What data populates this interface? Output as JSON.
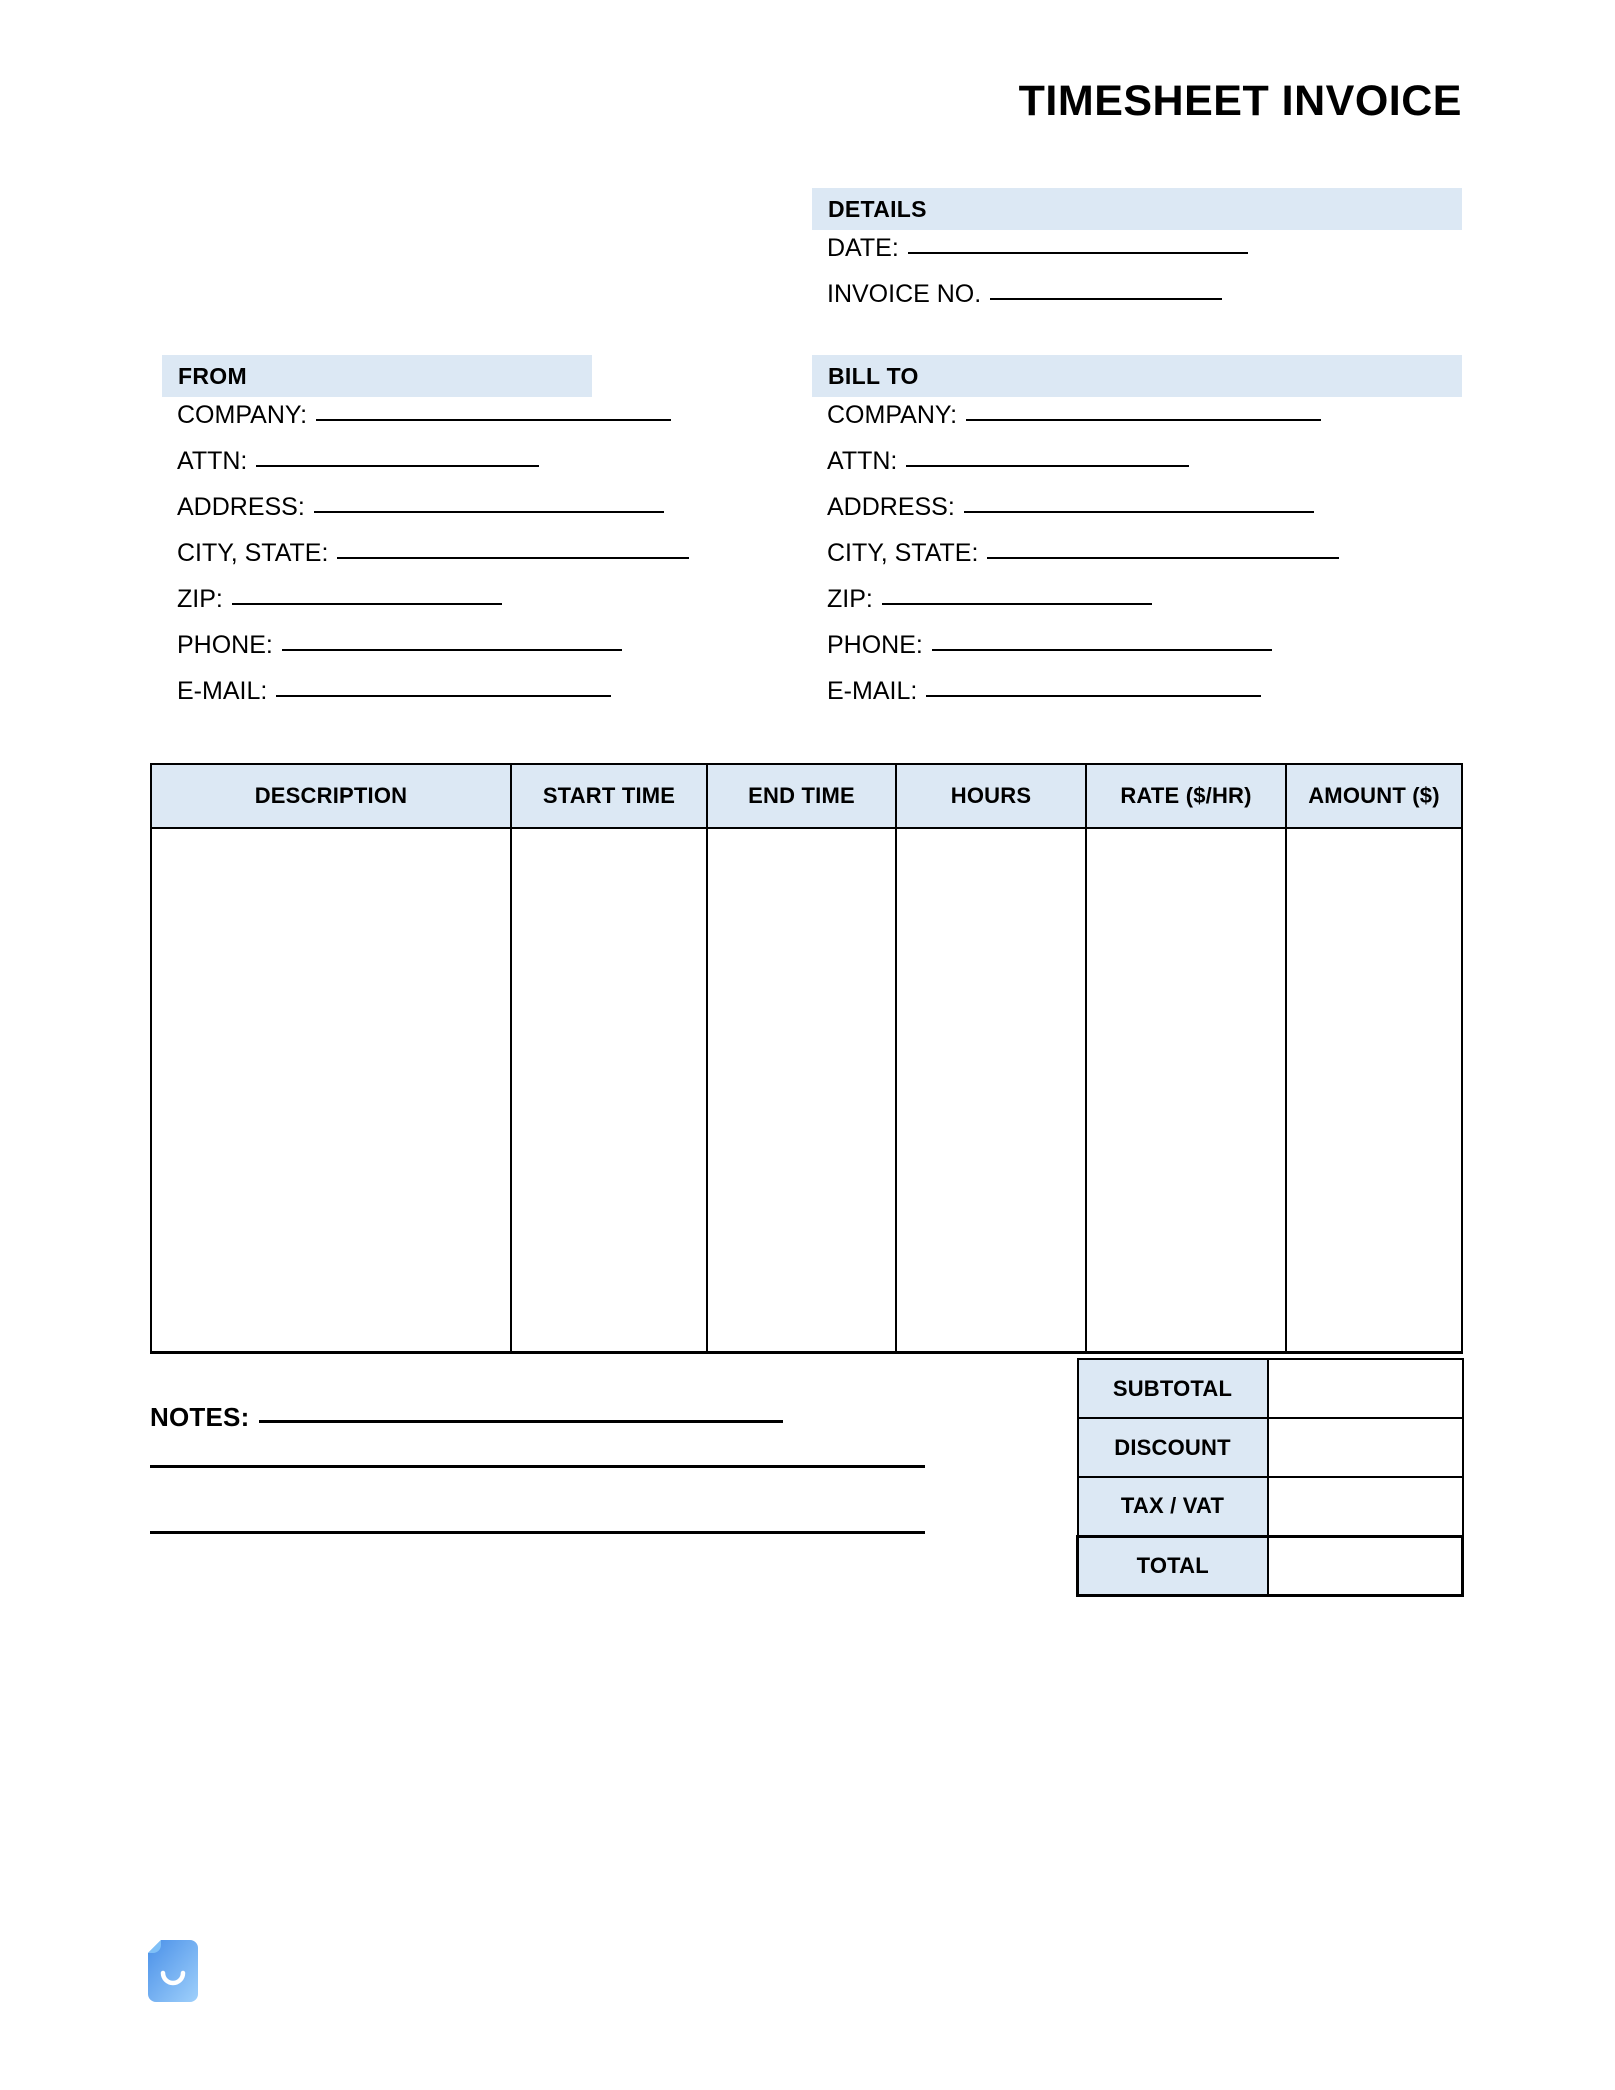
{
  "document": {
    "title": "TIMESHEET INVOICE"
  },
  "colors": {
    "band_background": "#dce8f4",
    "border": "#000000",
    "logo_gradient_start": "#4a90e8",
    "logo_gradient_end": "#9fd0fb"
  },
  "details": {
    "heading": "DETAILS",
    "fields": [
      {
        "label": "DATE:",
        "value": "",
        "rule_width": 340
      },
      {
        "label": "INVOICE NO.",
        "value": "",
        "rule_width": 232
      }
    ]
  },
  "from": {
    "heading": "FROM",
    "fields": [
      {
        "label": "COMPANY:",
        "value": "",
        "rule_width": 355
      },
      {
        "label": "ATTN:",
        "value": "",
        "rule_width": 283
      },
      {
        "label": "ADDRESS:",
        "value": "",
        "rule_width": 350
      },
      {
        "label": "CITY, STATE:",
        "value": "",
        "rule_width": 352
      },
      {
        "label": "ZIP:",
        "value": "",
        "rule_width": 270
      },
      {
        "label": "PHONE:",
        "value": "",
        "rule_width": 340
      },
      {
        "label": "E-MAIL:",
        "value": "",
        "rule_width": 335
      }
    ]
  },
  "bill_to": {
    "heading": "BILL TO",
    "fields": [
      {
        "label": "COMPANY:",
        "value": "",
        "rule_width": 355
      },
      {
        "label": "ATTN:",
        "value": "",
        "rule_width": 283
      },
      {
        "label": "ADDRESS:",
        "value": "",
        "rule_width": 350
      },
      {
        "label": "CITY, STATE:",
        "value": "",
        "rule_width": 352
      },
      {
        "label": "ZIP:",
        "value": "",
        "rule_width": 270
      },
      {
        "label": "PHONE:",
        "value": "",
        "rule_width": 340
      },
      {
        "label": "E-MAIL:",
        "value": "",
        "rule_width": 335
      }
    ]
  },
  "items_table": {
    "columns": [
      "DESCRIPTION",
      "START TIME",
      "END TIME",
      "HOURS",
      "RATE ($/HR)",
      "AMOUNT ($)"
    ],
    "rows": []
  },
  "totals": {
    "rows": [
      {
        "label": "SUBTOTAL",
        "value": ""
      },
      {
        "label": "DISCOUNT",
        "value": ""
      },
      {
        "label": "TAX / VAT",
        "value": ""
      },
      {
        "label": "TOTAL",
        "value": ""
      }
    ]
  },
  "notes": {
    "label": "NOTES:",
    "lines": [
      "",
      "",
      ""
    ]
  },
  "footer": {
    "logo_icon": "document-smile-logo"
  }
}
